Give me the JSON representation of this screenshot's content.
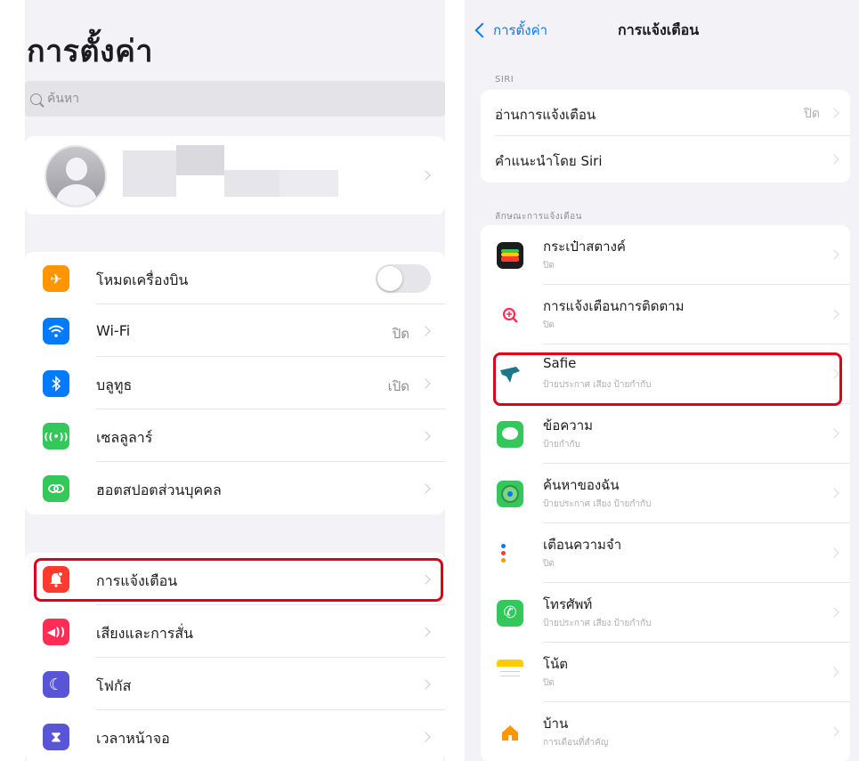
{
  "settings": {
    "title": "การตั้งค่า",
    "search_placeholder": "ค้นหา",
    "groups": [
      [
        {
          "label": "โหมดเครื่องบิน",
          "value": "",
          "icon": "airplane-icon",
          "color": "#ff9500",
          "toggle": true
        },
        {
          "label": "Wi-Fi",
          "value": "ปิด",
          "icon": "wifi-icon",
          "color": "#007aff"
        },
        {
          "label": "บลูทูธ",
          "value": "เปิด",
          "icon": "bluetooth-icon",
          "color": "#007aff"
        },
        {
          "label": "เซลลูลาร์",
          "value": "",
          "icon": "antenna-icon",
          "color": "#34c759"
        },
        {
          "label": "ฮอตสปอตส่วนบุคคล",
          "value": "",
          "icon": "hotspot-icon",
          "color": "#34c759"
        }
      ],
      [
        {
          "label": "การแจ้งเตือน",
          "value": "",
          "icon": "bell-icon",
          "color": "#ff3b30"
        },
        {
          "label": "เสียงและการสั่น",
          "value": "",
          "icon": "speaker-icon",
          "color": "#ff2d55"
        },
        {
          "label": "โฟกัส",
          "value": "",
          "icon": "moon-icon",
          "color": "#5856d6"
        },
        {
          "label": "เวลาหน้าจอ",
          "value": "",
          "icon": "hourglass-icon",
          "color": "#5856d6"
        }
      ]
    ]
  },
  "notifications": {
    "back_label": "การตั้งค่า",
    "title": "การแจ้งเตือน",
    "siri_header": "SIRI",
    "siri_rows": [
      {
        "label": "อ่านการแจ้งเตือน",
        "value": "ปิด"
      },
      {
        "label": "คำแนะนำโดย Siri",
        "value": ""
      }
    ],
    "apps_header": "ลักษณะการแจ้งเตือน",
    "apps": [
      {
        "name": "กระเป๋าสตางค์",
        "detail": "ปิด",
        "icon": "wallet-icon",
        "color": "#1c1c1e"
      },
      {
        "name": "การแจ้งเตือนการติดตาม",
        "detail": "ปิด",
        "icon": "tracking-icon",
        "color": "#ffffff"
      },
      {
        "name": "Safie",
        "detail": "ป้ายประกาศ เสียง ป้ายกำกับ",
        "icon": "safie-icon",
        "color": "#ffffff"
      },
      {
        "name": "ข้อความ",
        "detail": "ป้ายกำกับ",
        "icon": "messages-icon",
        "color": "#34c759"
      },
      {
        "name": "ค้นหาของฉัน",
        "detail": "ป้ายประกาศ เสียง ป้ายกำกับ",
        "icon": "findmy-icon",
        "color": "#34c759"
      },
      {
        "name": "เตือนความจำ",
        "detail": "ปิด",
        "icon": "reminders-icon",
        "color": "#ffffff"
      },
      {
        "name": "โทรศัพท์",
        "detail": "ป้ายประกาศ เสียง ป้ายกำกับ",
        "icon": "phone-icon",
        "color": "#34c759"
      },
      {
        "name": "โน้ต",
        "detail": "ปิด",
        "icon": "notes-icon",
        "color": "#ffffff"
      },
      {
        "name": "บ้าน",
        "detail": "การเตือนที่สำคัญ",
        "icon": "home-icon",
        "color": "#ffffff"
      }
    ]
  }
}
